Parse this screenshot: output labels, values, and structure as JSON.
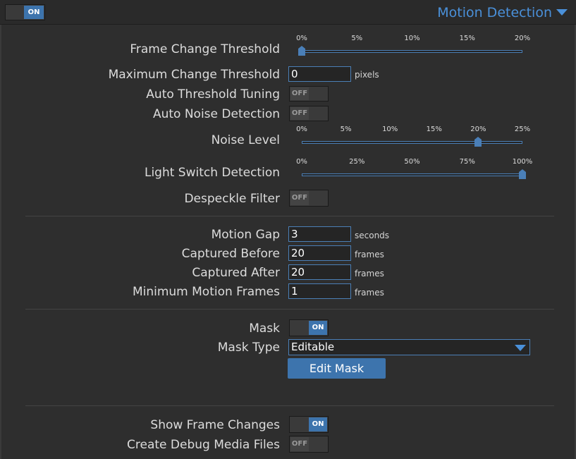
{
  "header": {
    "toggle": {
      "label": "ON",
      "state": "on"
    },
    "title": "Motion Detection",
    "accent": "#4a90d9"
  },
  "frame_change_threshold": {
    "label": "Frame Change Threshold",
    "ticks": [
      "0%",
      "5%",
      "10%",
      "15%",
      "20%"
    ],
    "value_fraction": 0.0
  },
  "maximum_change_threshold": {
    "label": "Maximum Change Threshold",
    "value": "0",
    "unit": "pixels"
  },
  "auto_threshold_tuning": {
    "label": "Auto Threshold Tuning",
    "toggle": "OFF"
  },
  "auto_noise_detection": {
    "label": "Auto Noise Detection",
    "toggle": "OFF"
  },
  "noise_level": {
    "label": "Noise Level",
    "ticks": [
      "0%",
      "5%",
      "10%",
      "15%",
      "20%",
      "25%"
    ],
    "value_fraction": 0.8
  },
  "light_switch_detection": {
    "label": "Light Switch Detection",
    "ticks": [
      "0%",
      "25%",
      "50%",
      "75%",
      "100%"
    ],
    "value_fraction": 1.0
  },
  "despeckle_filter": {
    "label": "Despeckle Filter",
    "toggle": "OFF"
  },
  "motion_gap": {
    "label": "Motion Gap",
    "value": "3",
    "unit": "seconds"
  },
  "captured_before": {
    "label": "Captured Before",
    "value": "20",
    "unit": "frames"
  },
  "captured_after": {
    "label": "Captured After",
    "value": "20",
    "unit": "frames"
  },
  "minimum_motion_frames": {
    "label": "Minimum Motion Frames",
    "value": "1",
    "unit": "frames"
  },
  "mask": {
    "label": "Mask",
    "toggle": "ON"
  },
  "mask_type": {
    "label": "Mask Type",
    "value": "Editable"
  },
  "edit_mask_button": "Edit Mask",
  "show_frame_changes": {
    "label": "Show Frame Changes",
    "toggle": "ON"
  },
  "create_debug_media_files": {
    "label": "Create Debug Media Files",
    "toggle": "OFF"
  }
}
